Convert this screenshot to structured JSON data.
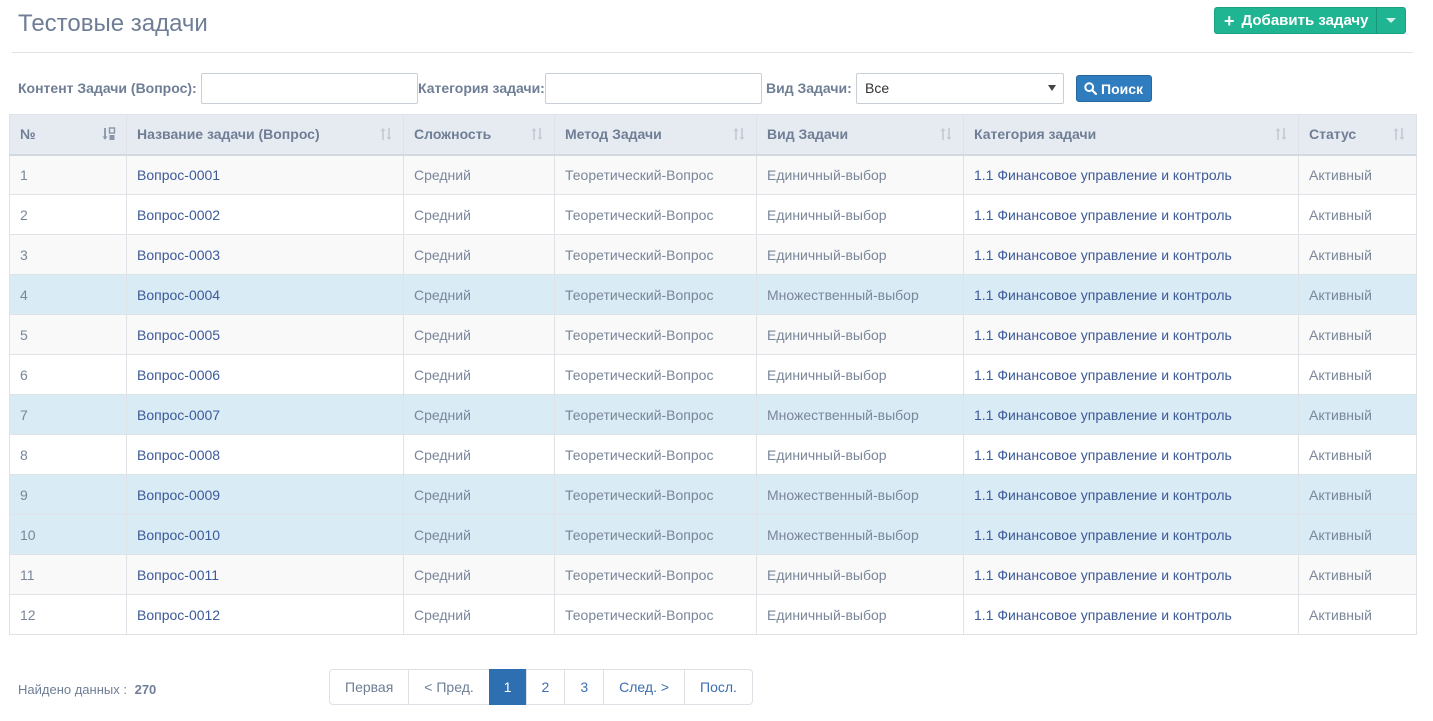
{
  "page": {
    "title": "Тестовые задачи"
  },
  "toolbar": {
    "add_label": "Добавить задачу"
  },
  "filters": {
    "content_label": "Контент Задачи (Вопрос):",
    "content_value": "",
    "category_label": "Категория задачи:",
    "category_value": "",
    "type_label": "Вид Задачи:",
    "type_selected": "Все",
    "search_label": "Поиск"
  },
  "table": {
    "columns": [
      "№",
      "Название задачи (Вопрос)",
      "Сложность",
      "Метод Задачи",
      "Вид Задачи",
      "Категория задачи",
      "Статус"
    ],
    "rows": [
      {
        "num": "1",
        "name": "Вопрос-0001",
        "difficulty": "Средний",
        "method": "Теоретический-Вопрос",
        "type": "Единичный-выбор",
        "category": "1.1 Финансовое управление и контроль",
        "status": "Активный",
        "highlight": false
      },
      {
        "num": "2",
        "name": "Вопрос-0002",
        "difficulty": "Средний",
        "method": "Теоретический-Вопрос",
        "type": "Единичный-выбор",
        "category": "1.1 Финансовое управление и контроль",
        "status": "Активный",
        "highlight": false
      },
      {
        "num": "3",
        "name": "Вопрос-0003",
        "difficulty": "Средний",
        "method": "Теоретический-Вопрос",
        "type": "Единичный-выбор",
        "category": "1.1 Финансовое управление и контроль",
        "status": "Активный",
        "highlight": false
      },
      {
        "num": "4",
        "name": "Вопрос-0004",
        "difficulty": "Средний",
        "method": "Теоретический-Вопрос",
        "type": "Множественный-выбор",
        "category": "1.1 Финансовое управление и контроль",
        "status": "Активный",
        "highlight": true
      },
      {
        "num": "5",
        "name": "Вопрос-0005",
        "difficulty": "Средний",
        "method": "Теоретический-Вопрос",
        "type": "Единичный-выбор",
        "category": "1.1 Финансовое управление и контроль",
        "status": "Активный",
        "highlight": false
      },
      {
        "num": "6",
        "name": "Вопрос-0006",
        "difficulty": "Средний",
        "method": "Теоретический-Вопрос",
        "type": "Единичный-выбор",
        "category": "1.1 Финансовое управление и контроль",
        "status": "Активный",
        "highlight": false
      },
      {
        "num": "7",
        "name": "Вопрос-0007",
        "difficulty": "Средний",
        "method": "Теоретический-Вопрос",
        "type": "Множественный-выбор",
        "category": "1.1 Финансовое управление и контроль",
        "status": "Активный",
        "highlight": true
      },
      {
        "num": "8",
        "name": "Вопрос-0008",
        "difficulty": "Средний",
        "method": "Теоретический-Вопрос",
        "type": "Единичный-выбор",
        "category": "1.1 Финансовое управление и контроль",
        "status": "Активный",
        "highlight": false
      },
      {
        "num": "9",
        "name": "Вопрос-0009",
        "difficulty": "Средний",
        "method": "Теоретический-Вопрос",
        "type": "Множественный-выбор",
        "category": "1.1 Финансовое управление и контроль",
        "status": "Активный",
        "highlight": true
      },
      {
        "num": "10",
        "name": "Вопрос-0010",
        "difficulty": "Средний",
        "method": "Теоретический-Вопрос",
        "type": "Множественный-выбор",
        "category": "1.1 Финансовое управление и контроль",
        "status": "Активный",
        "highlight": true
      },
      {
        "num": "11",
        "name": "Вопрос-0011",
        "difficulty": "Средний",
        "method": "Теоретический-Вопрос",
        "type": "Единичный-выбор",
        "category": "1.1 Финансовое управление и контроль",
        "status": "Активный",
        "highlight": false
      },
      {
        "num": "12",
        "name": "Вопрос-0012",
        "difficulty": "Средний",
        "method": "Теоретический-Вопрос",
        "type": "Единичный-выбор",
        "category": "1.1 Финансовое управление и контроль",
        "status": "Активный",
        "highlight": false
      }
    ]
  },
  "footer": {
    "found_label": "Найдено данных :",
    "found_count": "270"
  },
  "pagination": {
    "first": "Первая",
    "prev": "< Пред.",
    "pages": [
      "1",
      "2",
      "3"
    ],
    "current": "1",
    "next": "След. >",
    "last": "Посл."
  },
  "colors": {
    "accent_green": "#1fb593",
    "accent_blue": "#2e6fb2",
    "link": "#3d5a99",
    "row_highlight": "#d9ebf5"
  },
  "icons": {
    "add": "plus-icon",
    "add_menu": "caret-down-icon",
    "search": "search-icon",
    "sort_active": "sort-numeric-asc-icon",
    "sort": "sort-icon"
  }
}
